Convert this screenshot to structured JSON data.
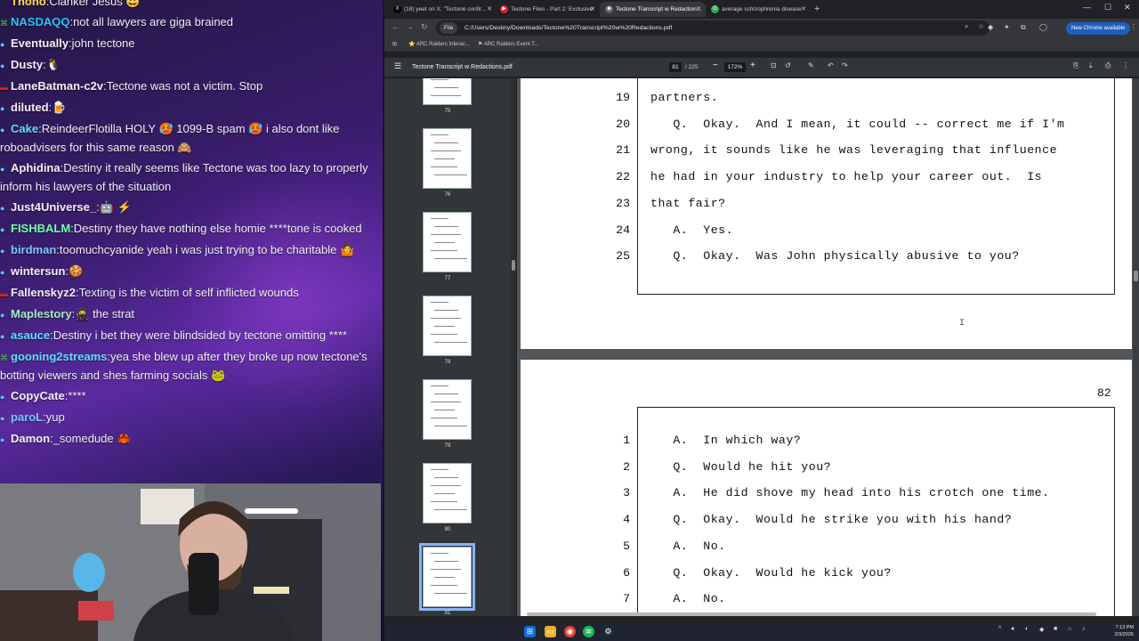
{
  "chat": [
    {
      "badge": "",
      "badge_color": "#e05050",
      "user": "Thono",
      "user_color": "#ffde59",
      "text": "Clanker Jesus 😀"
    },
    {
      "badge": "⌘",
      "badge_color": "#50d050",
      "user": "NASDAQQ",
      "user_color": "#2ec2ff",
      "text": "not all lawyers are giga brained"
    },
    {
      "badge": "●",
      "badge_color": "#57c7ff",
      "user": "Eventually",
      "user_color": "#f3eff9",
      "text": "john tectone"
    },
    {
      "badge": "●",
      "badge_color": "#57c7ff",
      "user": "Dusty",
      "user_color": "#f3eff9",
      "text": "🐧"
    },
    {
      "badge": "▬",
      "badge_color": "#e02020",
      "user": "LaneBatman-c2v",
      "user_color": "#f3eff9",
      "text": "Tectone was not a victim. Stop"
    },
    {
      "badge": "●",
      "badge_color": "#57c7ff",
      "user": "diluted",
      "user_color": "#f3eff9",
      "text": "🍺"
    },
    {
      "badge": "●",
      "badge_color": "#57c7ff",
      "user": "Cake",
      "user_color": "#5fe0ff",
      "text": "ReindeerFlotilla HOLY 🥵 1099-B spam 🥵 i also dont like roboadvisers for this same reason 🙈"
    },
    {
      "badge": "●",
      "badge_color": "#57c7ff",
      "user": "Aphidina",
      "user_color": "#f3eff9",
      "text": "Destiny it really seems like Tectone was too lazy to properly inform his lawyers of the situation"
    },
    {
      "badge": "●",
      "badge_color": "#57c7ff",
      "user": "Just4Universe_",
      "user_color": "#f3eff9",
      "text": "🤖 ⚡"
    },
    {
      "badge": "●",
      "badge_color": "#57c7ff",
      "user": "FISHBALM",
      "user_color": "#74ffad",
      "text": "Destiny they have nothing else homie ****tone is cooked"
    },
    {
      "badge": "●",
      "badge_color": "#57c7ff",
      "user": "birdman",
      "user_color": "#7ac8ff",
      "text": "toomuchcyanide yeah i was just trying to be charitable 🤷"
    },
    {
      "badge": "●",
      "badge_color": "#57c7ff",
      "user": "wintersun",
      "user_color": "#f3eff9",
      "text": "🍪"
    },
    {
      "badge": "▬",
      "badge_color": "#e02020",
      "user": "Fallenskyz2",
      "user_color": "#f3eff9",
      "text": "Texting is the victim of self inflicted wounds"
    },
    {
      "badge": "●",
      "badge_color": "#57c7ff",
      "user": "Maplestory",
      "user_color": "#9ff0b8",
      "text": "🥷 the strat"
    },
    {
      "badge": "●",
      "badge_color": "#57c7ff",
      "user": "asauce",
      "user_color": "#5fe0ff",
      "text": "Destiny i bet they were blindsided by tectone omitting ****"
    },
    {
      "badge": "⌘",
      "badge_color": "#50d050",
      "user": "gooning2streams",
      "user_color": "#5fe0ff",
      "text": "yea she blew up after they broke up now tectone's botting viewers and shes farming socials 🐸"
    },
    {
      "badge": "●",
      "badge_color": "#57c7ff",
      "user": "CopyCate",
      "user_color": "#f3eff9",
      "text": "****"
    },
    {
      "badge": "●",
      "badge_color": "#57c7ff",
      "user": "paroL",
      "user_color": "#7ac8ff",
      "text": "yup"
    },
    {
      "badge": "●",
      "badge_color": "#57c7ff",
      "user": "Damon",
      "user_color": "#f3eff9",
      "text": "_somedude 🦀"
    }
  ],
  "browser": {
    "tabs": [
      {
        "title": "(18) yeet on X: \"Tectone confir...",
        "icon": "X",
        "icon_color": "#000000"
      },
      {
        "title": "Tectone Files - Part 2: Exclusive",
        "icon": "▶",
        "icon_color": "#e02020"
      },
      {
        "title": "Tectone Transcript w Redaction...",
        "icon": "◉",
        "icon_color": "#5f6368"
      },
      {
        "title": "average schizophrenia disease",
        "icon": "G",
        "icon_color": "#34a853"
      }
    ],
    "new_tab": "+",
    "url_chip": "File",
    "url": "C:/Users/Destiny/Downloads/Tectone%20Transcript%20w%20Redactions.pdf",
    "bookmarks": [
      "ARC Raiders Interac...",
      "ARC Raiders Event T..."
    ],
    "new_chrome": "New Chrome available"
  },
  "pdf": {
    "title": "Tectone Transcript w Redactions.pdf",
    "page": "81",
    "total": "/ 225",
    "zoom": "172%",
    "thumb_numbers": [
      "75",
      "76",
      "77",
      "78",
      "79",
      "80",
      "81"
    ],
    "current_page_label": "82",
    "page1_lines": [
      {
        "n": "19",
        "t": "partners."
      },
      {
        "n": "20",
        "t": "   Q.  Okay.  And I mean, it could -- correct me if I'm"
      },
      {
        "n": "21",
        "t": "wrong, it sounds like he was leveraging that influence"
      },
      {
        "n": "22",
        "t": "he had in your industry to help your career out.  Is"
      },
      {
        "n": "23",
        "t": "that fair?"
      },
      {
        "n": "24",
        "t": "   A.  Yes."
      },
      {
        "n": "25",
        "t": "   Q.  Okay.  Was John physically abusive to you?"
      }
    ],
    "page2_lines": [
      {
        "n": "1",
        "t": "   A.  In which way?"
      },
      {
        "n": "2",
        "t": "   Q.  Would he hit you?"
      },
      {
        "n": "3",
        "t": "   A.  He did shove my head into his crotch one time."
      },
      {
        "n": "4",
        "t": "   Q.  Okay.  Would he strike you with his hand?"
      },
      {
        "n": "5",
        "t": "   A.  No."
      },
      {
        "n": "6",
        "t": "   Q.  Okay.  Would he kick you?"
      },
      {
        "n": "7",
        "t": "   A.  No."
      }
    ]
  },
  "taskbar": {
    "time": "7:13 PM",
    "date": "2/3/2026"
  }
}
